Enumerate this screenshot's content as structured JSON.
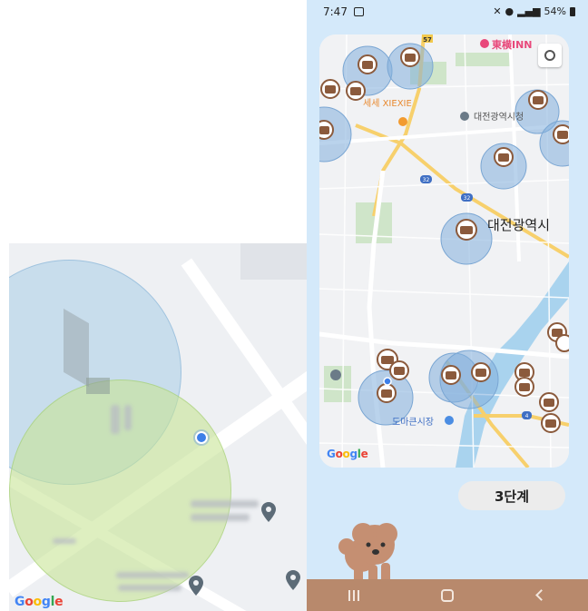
{
  "left_map": {
    "google_logo": [
      "G",
      "o",
      "o",
      "g",
      "l",
      "e"
    ]
  },
  "phone": {
    "status_bar": {
      "time": "7:47",
      "battery": "54%"
    },
    "map": {
      "labels": [
        {
          "text": "東横INN",
          "kind": "poi-pink"
        },
        {
          "text": "세세 XIEXIE",
          "kind": "poi-orange"
        },
        {
          "text": "대전광역시청",
          "kind": "poi-gray"
        },
        {
          "text": "대전광역시",
          "kind": "city"
        },
        {
          "text": "도마큰시장",
          "kind": "poi-blue"
        }
      ],
      "road_badges": [
        "57",
        "32",
        "32",
        "4"
      ],
      "google_logo": [
        "G",
        "o",
        "o",
        "g",
        "l",
        "e"
      ]
    },
    "stage_button": "3단계",
    "colors": {
      "background": "#d4e9fa",
      "nav": "#b8896c",
      "marker_circle": "#8fb5dc",
      "marker_icon": "#8b5a3c"
    }
  }
}
